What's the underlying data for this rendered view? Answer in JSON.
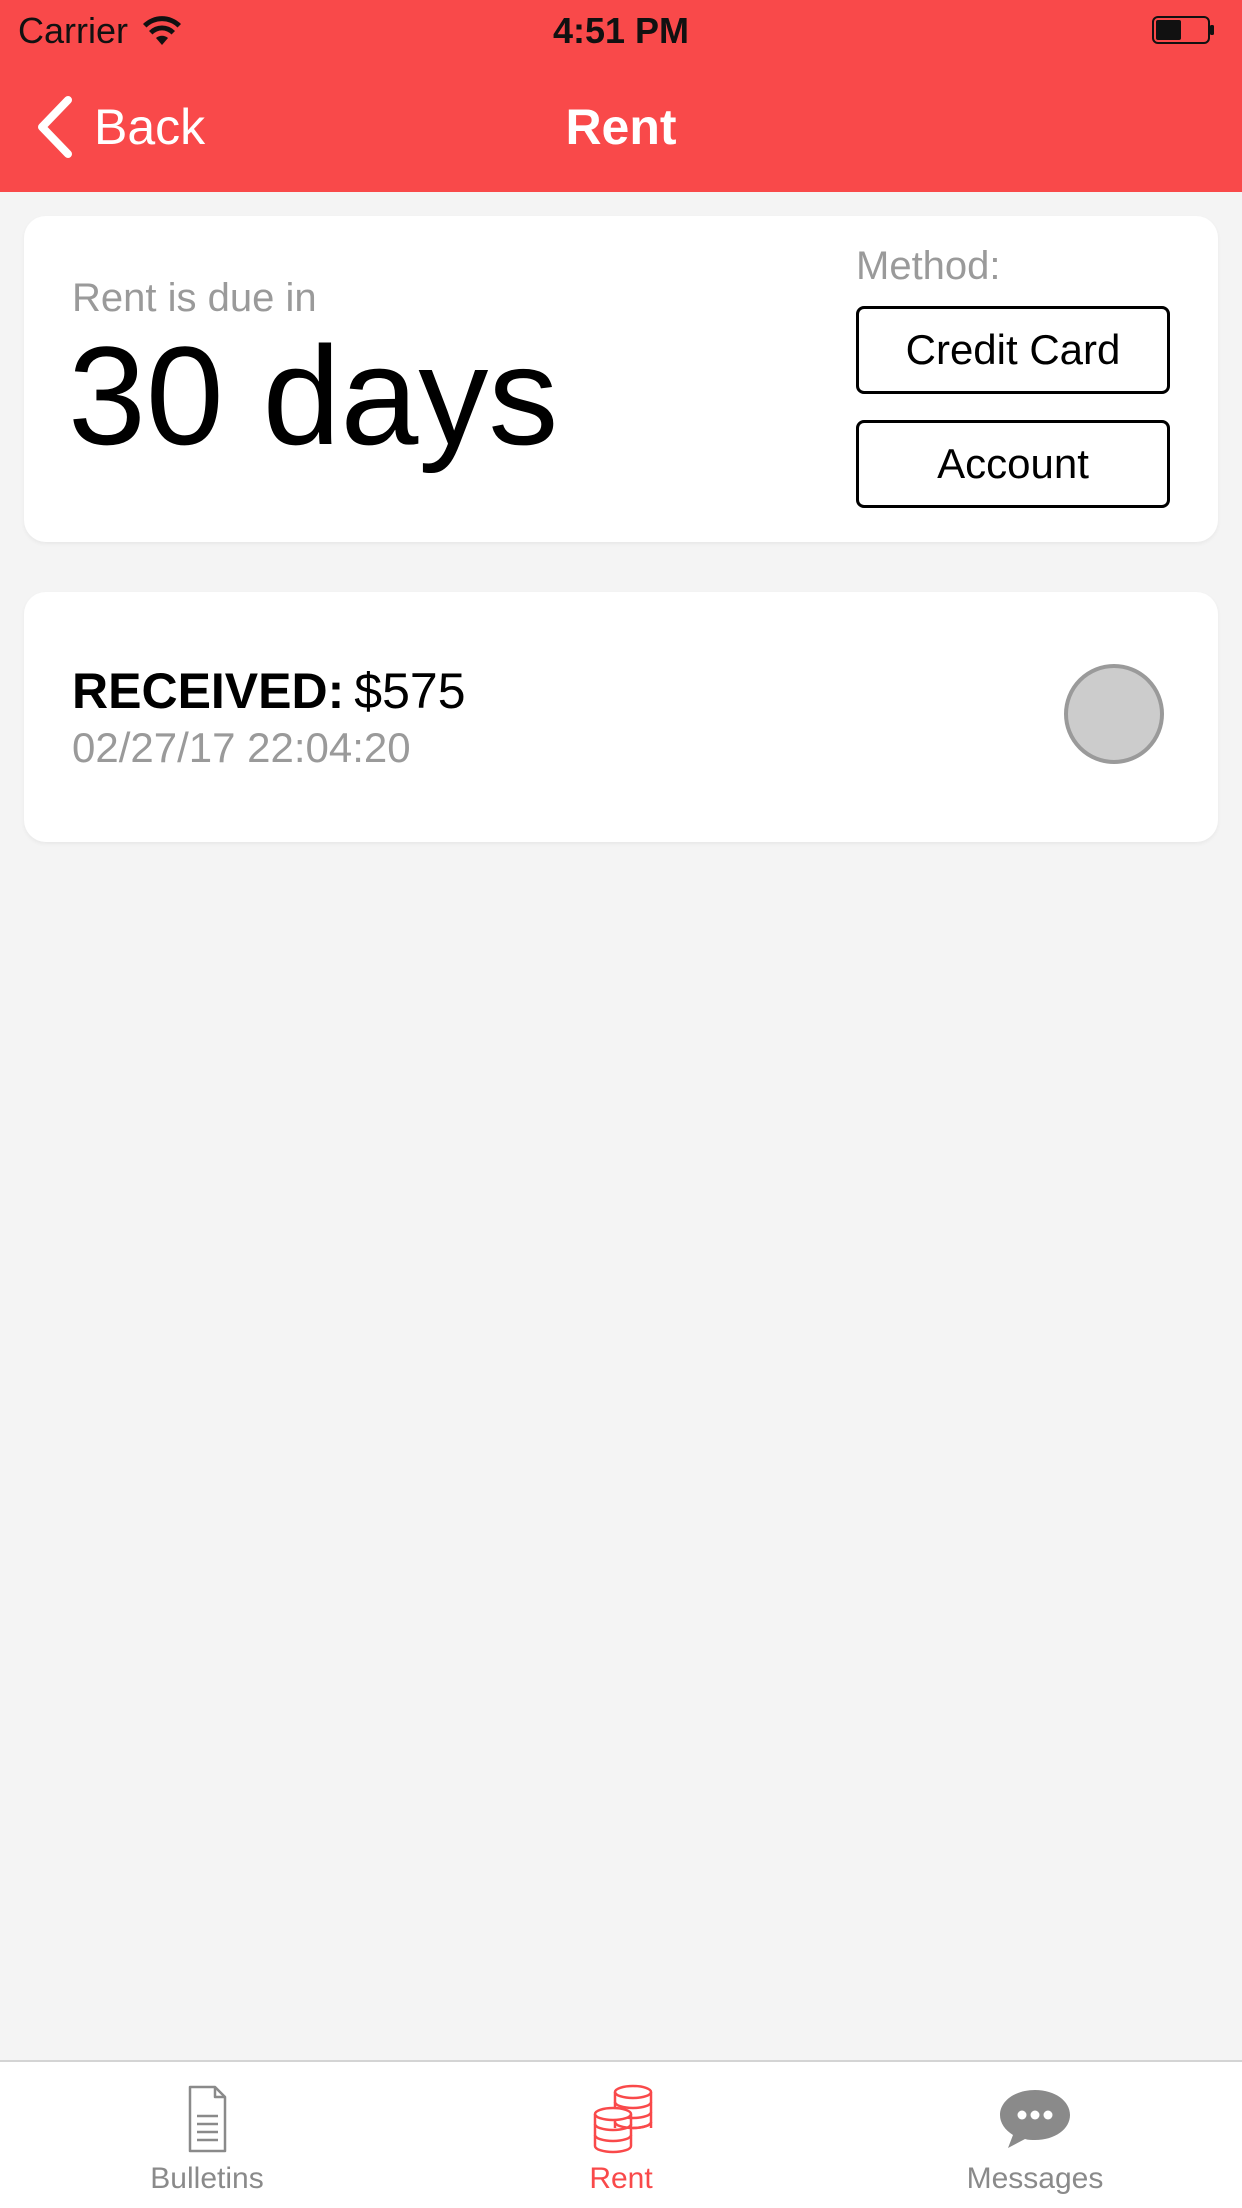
{
  "status_bar": {
    "carrier": "Carrier",
    "time": "4:51 PM",
    "battery_level": 0.5
  },
  "navbar": {
    "back_label": "Back",
    "title": "Rent"
  },
  "due_card": {
    "label": "Rent is due in",
    "value": "30 days",
    "method_label": "Method:",
    "methods": [
      "Credit Card",
      "Account"
    ]
  },
  "payments": [
    {
      "status": "RECEIVED:",
      "amount": "$575",
      "date": "02/27/17 22:04:20"
    }
  ],
  "tabs": [
    {
      "label": "Bulletins",
      "icon": "document-icon",
      "active": false
    },
    {
      "label": "Rent",
      "icon": "coins-icon",
      "active": true
    },
    {
      "label": "Messages",
      "icon": "chat-bubble-icon",
      "active": false
    }
  ],
  "colors": {
    "accent": "#f9494a",
    "background": "#f4f4f4",
    "muted_text": "#9a9a9a"
  }
}
